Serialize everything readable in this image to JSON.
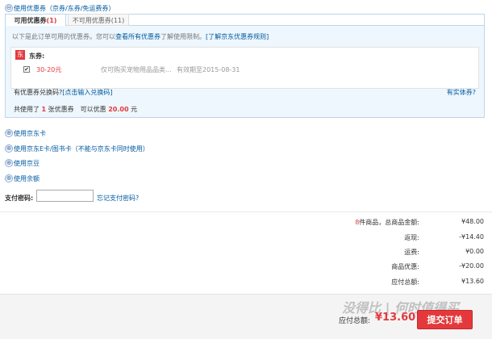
{
  "coupon_section": {
    "toggle_symbol": "⊖",
    "title": "使用优惠券（京券/东券/免运费券）",
    "tabs": [
      {
        "label": "可用优惠券",
        "count": "(1)"
      },
      {
        "label": "不可用优惠券",
        "count": "(11)"
      }
    ],
    "notice_prefix": "以下是此订单可用的优惠券。您可以",
    "notice_link": "查看所有优惠券",
    "notice_middle": "了解使用限制。",
    "notice_link2": "[了解京东优惠券规则]",
    "group_badge": "东",
    "group_label": "东券:",
    "coupon": {
      "checked": "✔",
      "amount": "30-20元",
      "scope": "仅可购买宠物用品品类...",
      "expiry": "有效期至2015-08-31"
    },
    "code_prompt": "有优惠券兑换码?",
    "code_link": "[点击输入兑换码]",
    "physical_link": "有实体券?",
    "summary_prefix": "共使用了",
    "summary_count": "1",
    "summary_mid": "张优惠券　可以优惠",
    "summary_amount": "20.00",
    "summary_suffix": "元"
  },
  "options": [
    {
      "toggle": "⊕",
      "label": "使用京东卡"
    },
    {
      "toggle": "⊕",
      "label": "使用京东E卡/图书卡（不能与京东卡同时使用）"
    },
    {
      "toggle": "⊕",
      "label": "使用京豆"
    },
    {
      "toggle": "⊕",
      "label": "使用余额"
    }
  ],
  "payment_password": {
    "label": "支付密码:",
    "value": "",
    "forgot_link": "忘记支付密码?"
  },
  "summary": {
    "items_count": "8",
    "items_label": "件商品，总商品金额:",
    "items_value": "¥48.00",
    "rebate_label": "返现:",
    "rebate_value": "-¥14.40",
    "shipping_label": "运费:",
    "shipping_value": "¥0.00",
    "discount_label": "商品优惠:",
    "discount_value": "-¥20.00",
    "total_label": "应付总额:",
    "total_value": "¥13.60"
  },
  "footer": {
    "payable_label": "应付总额:",
    "payable_value": "¥13.60",
    "submit_label": "提交订单",
    "watermark": "没得比 | 何时值得买"
  },
  "colors": {
    "accent_blue": "#005aa0",
    "price_red": "#e4393c",
    "panel_bg": "#eef7fd"
  }
}
